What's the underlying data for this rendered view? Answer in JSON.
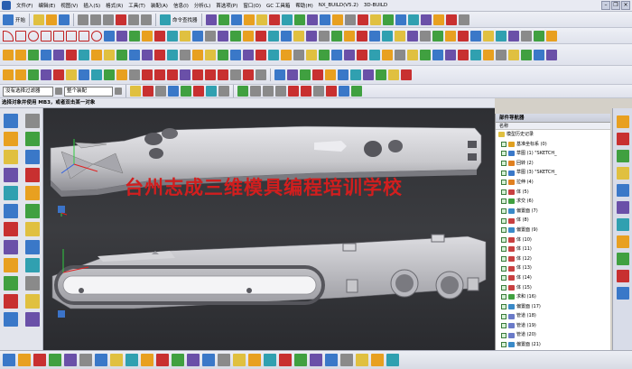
{
  "menubar": {
    "items": [
      "文件(F)",
      "编辑(E)",
      "视图(V)",
      "插入(S)",
      "格式(R)",
      "工具(T)",
      "装配(A)",
      "信息(I)",
      "分析(L)",
      "首选项(P)",
      "窗口(O)",
      "GC 工具箱",
      "帮助(H)",
      "NX_BUILD(V5.2)",
      "3D-BUILD"
    ]
  },
  "toolbar": {
    "start_label": "开始",
    "command_finder_label": "命令查找器"
  },
  "selection": {
    "filter_value": "没有选择过滤器",
    "scope_value": "整个装配"
  },
  "status_bar": {
    "message": "选择对象并使用 MB3，或者双击某一对象"
  },
  "watermark": {
    "text": "台州志成三维模具编程培训学校"
  },
  "part_navigator": {
    "title": "部件导航器",
    "column_name": "名称",
    "root": "模型历史记录",
    "rows": [
      {
        "label": "基准坐标系 (0)",
        "icon": "csys-icon"
      },
      {
        "label": "草图 (1) \"SKETCH_",
        "icon": "sketch-icon"
      },
      {
        "label": "回转 (2)",
        "icon": "revolve-icon"
      },
      {
        "label": "草图 (3) \"SKETCH_",
        "icon": "sketch-icon"
      },
      {
        "label": "拉伸 (4)",
        "icon": "extrude-icon"
      },
      {
        "label": "体 (5)",
        "icon": "body-icon"
      },
      {
        "label": "求交 (6)",
        "icon": "intersect-icon"
      },
      {
        "label": "偏置面 (7)",
        "icon": "offset-face-icon"
      },
      {
        "label": "体 (8)",
        "icon": "body-icon"
      },
      {
        "label": "偏置面 (9)",
        "icon": "offset-face-icon"
      },
      {
        "label": "体 (10)",
        "icon": "body-icon"
      },
      {
        "label": "体 (11)",
        "icon": "body-icon"
      },
      {
        "label": "体 (12)",
        "icon": "body-icon"
      },
      {
        "label": "体 (13)",
        "icon": "body-icon"
      },
      {
        "label": "体 (14)",
        "icon": "body-icon"
      },
      {
        "label": "体 (15)",
        "icon": "body-icon"
      },
      {
        "label": "求和 (16)",
        "icon": "unite-icon"
      },
      {
        "label": "偏置面 (17)",
        "icon": "offset-face-icon"
      },
      {
        "label": "管道 (18)",
        "icon": "tube-icon"
      },
      {
        "label": "管道 (19)",
        "icon": "tube-icon"
      },
      {
        "label": "管道 (20)",
        "icon": "tube-icon"
      },
      {
        "label": "偏置面 (21)",
        "icon": "offset-face-icon"
      }
    ]
  },
  "colors": {
    "viewport_bg": "#2a2b2f",
    "part_color": "#c8c8cc",
    "watermark": "#d21e1e"
  }
}
